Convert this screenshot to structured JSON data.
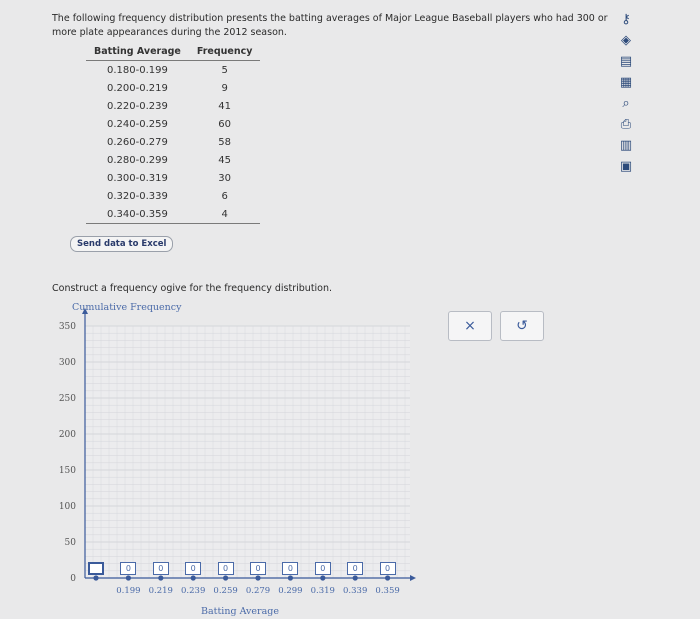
{
  "prompt_text": "The following frequency distribution presents the batting averages of Major League Baseball players who had 300 or more plate appearances during the 2012 season.",
  "table": {
    "headers": [
      "Batting Average",
      "Frequency"
    ],
    "rows": [
      [
        "0.180-0.199",
        "5"
      ],
      [
        "0.200-0.219",
        "9"
      ],
      [
        "0.220-0.239",
        "41"
      ],
      [
        "0.240-0.259",
        "60"
      ],
      [
        "0.260-0.279",
        "58"
      ],
      [
        "0.280-0.299",
        "45"
      ],
      [
        "0.300-0.319",
        "30"
      ],
      [
        "0.320-0.339",
        "6"
      ],
      [
        "0.340-0.359",
        "4"
      ]
    ]
  },
  "excel_button": "Send data to Excel",
  "instruction": "Construct a frequency ogive for the frequency distribution.",
  "chart_data": {
    "type": "line",
    "ylabel": "Cumulative Frequency",
    "xlabel": "Batting Average",
    "ylim": [
      0,
      350
    ],
    "y_ticks": [
      "0",
      "50",
      "100",
      "150",
      "200",
      "250",
      "300",
      "350"
    ],
    "x_ticks": [
      "0.199",
      "0.219",
      "0.239",
      "0.259",
      "0.279",
      "0.299",
      "0.319",
      "0.339",
      "0.359"
    ],
    "input_values": [
      "",
      "0",
      "0",
      "0",
      "0",
      "0",
      "0",
      "0",
      "0",
      "0"
    ],
    "points_y": [
      0,
      0,
      0,
      0,
      0,
      0,
      0,
      0,
      0,
      0
    ],
    "grid": true
  },
  "buttons": {
    "clear_symbol": "×",
    "undo_symbol": "↺"
  },
  "colors": {
    "accent": "#3a5a9a",
    "grid": "#d4d6da",
    "axis": "#3a5a9a"
  },
  "toolbar_icons": [
    "key-icon",
    "check-diamond-icon",
    "document-icon",
    "calculator-icon",
    "search-text-icon",
    "print-icon",
    "bar-chart-icon",
    "folder-icon"
  ]
}
